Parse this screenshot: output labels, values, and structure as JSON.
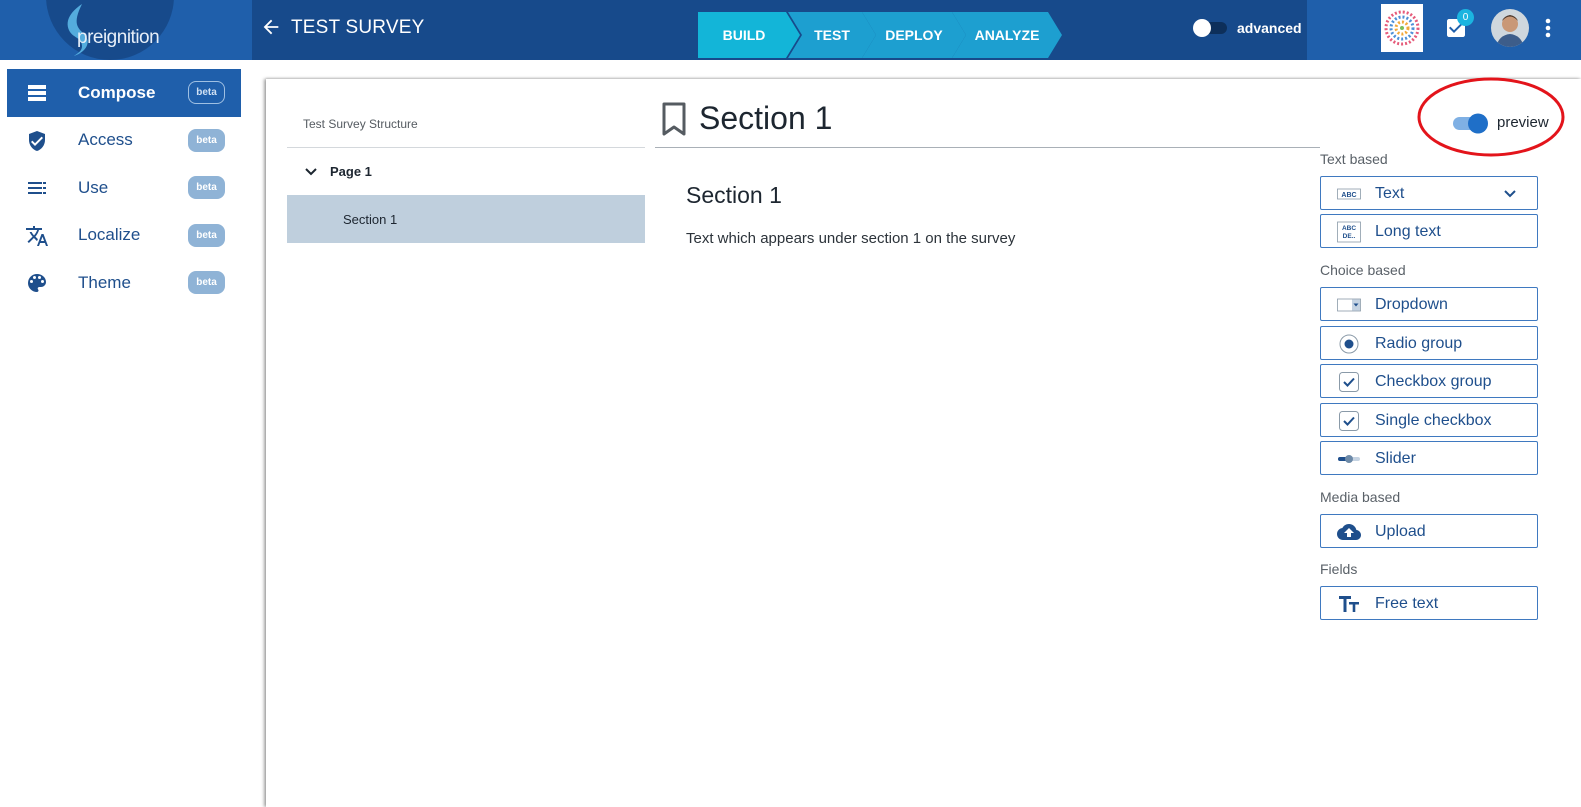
{
  "brand": {
    "logo_text": "preignition"
  },
  "header": {
    "title": "TEST SURVEY",
    "steps": [
      "BUILD",
      "TEST",
      "DEPLOY",
      "ANALYZE"
    ],
    "active_step": "BUILD",
    "advanced_label": "advanced",
    "advanced_on": false,
    "task_count": "0"
  },
  "sidenav": {
    "items": [
      {
        "label": "Compose",
        "badge": "beta",
        "icon": "compose-icon",
        "active": true
      },
      {
        "label": "Access",
        "badge": "beta",
        "icon": "shield-icon",
        "active": false
      },
      {
        "label": "Use",
        "badge": "beta",
        "icon": "list-icon",
        "active": false
      },
      {
        "label": "Localize",
        "badge": "beta",
        "icon": "translate-icon",
        "active": false
      },
      {
        "label": "Theme",
        "badge": "beta",
        "icon": "palette-icon",
        "active": false
      }
    ]
  },
  "structure": {
    "title": "Test Survey Structure",
    "page_label": "Page 1",
    "section_label": "Section 1"
  },
  "editor": {
    "heading": "Section 1",
    "preview_label": "preview",
    "preview_on": true,
    "content_title": "Section 1",
    "content_text": "Text which appears under section 1 on the survey"
  },
  "palette": {
    "groups": [
      {
        "label": "Text based",
        "items": [
          "Text",
          "Long text"
        ]
      },
      {
        "label": "Choice based",
        "items": [
          "Dropdown",
          "Radio group",
          "Checkbox group",
          "Single checkbox",
          "Slider"
        ]
      },
      {
        "label": "Media based",
        "items": [
          "Upload"
        ]
      },
      {
        "label": "Fields",
        "items": [
          "Free text"
        ]
      }
    ]
  },
  "colors": {
    "header_bg": "#174a8b",
    "brand_blue": "#1f5fab",
    "step_active": "#13b5d8",
    "step_inactive": "#1d9fd0",
    "beta_badge": "#8fb3d6",
    "selected_row": "#bfcfdd",
    "annotation_red": "#e3141b"
  }
}
